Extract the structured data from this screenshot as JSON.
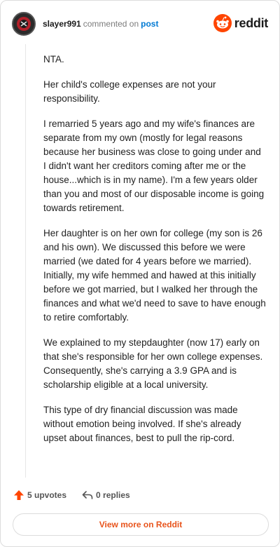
{
  "header": {
    "username": "slayer991",
    "commented_text": "commented on",
    "post_link": "post",
    "logo_text": "reddit"
  },
  "comment": {
    "paragraphs": [
      "NTA.",
      "Her child's college expenses are not your responsibility.",
      "I remarried 5 years ago and my wife's finances are separate from my own (mostly for legal reasons because her business was close to going under and I didn't want her creditors coming after me or the house...which is in my name). I'm a few years older than you and most of our disposable income is going towards retirement.",
      "Her daughter is on her own for college (my son is 26 and his own). We discussed this before we were married (we dated for 4 years before we married). Initially, my wife hemmed and hawed at this initially before we got married, but I walked her through the finances and what we'd need to save to have enough to retire comfortably.",
      "We explained to my stepdaughter (now 17) early on that she's responsible for her own college expenses. Consequently, she's carrying a 3.9 GPA and is scholarship eligible at a local university.",
      "This type of dry financial discussion was made without emotion being involved. If she's already upset about finances, best to pull the rip-cord."
    ]
  },
  "actions": {
    "upvotes": "5 upvotes",
    "replies": "0 replies"
  },
  "footer": {
    "view_more": "View more on Reddit"
  },
  "colors": {
    "accent": "#e8541c",
    "link": "#0079d3",
    "upvote": "#ff4500"
  }
}
